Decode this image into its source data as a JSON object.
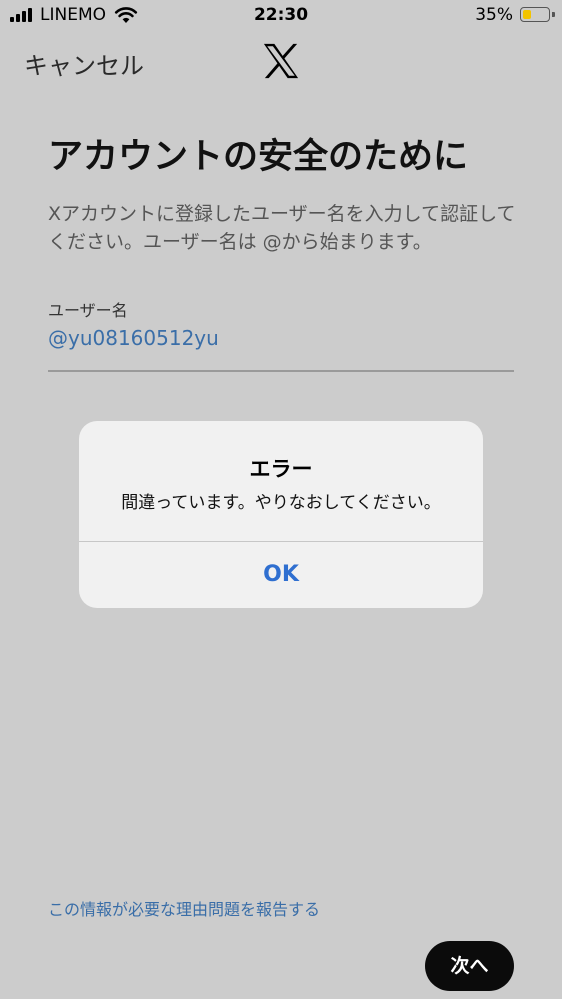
{
  "status_bar": {
    "carrier": "LINEMO",
    "time": "22:30",
    "battery_percent": "35%",
    "battery_level": 0.35,
    "battery_color": "#f2c400"
  },
  "nav": {
    "cancel_label": "キャンセル",
    "logo_icon": "x-logo-icon"
  },
  "main": {
    "title": "アカウントの安全のために",
    "description": "Xアカウントに登録したユーザー名を入力して認証してください。ユーザー名は @から始まります。",
    "username_label": "ユーザー名",
    "username_value": "@yu08160512yu"
  },
  "alert": {
    "title": "エラー",
    "message": "間違っています。やりなおしてください。",
    "ok_label": "OK"
  },
  "footer": {
    "report_link": "この情報が必要な理由問題を報告する",
    "next_label": "次へ"
  },
  "colors": {
    "link": "#3a6ea8",
    "alert_button": "#2f6fd0",
    "primary_button": "#0b0b0b",
    "backdrop": "#cccccc"
  }
}
